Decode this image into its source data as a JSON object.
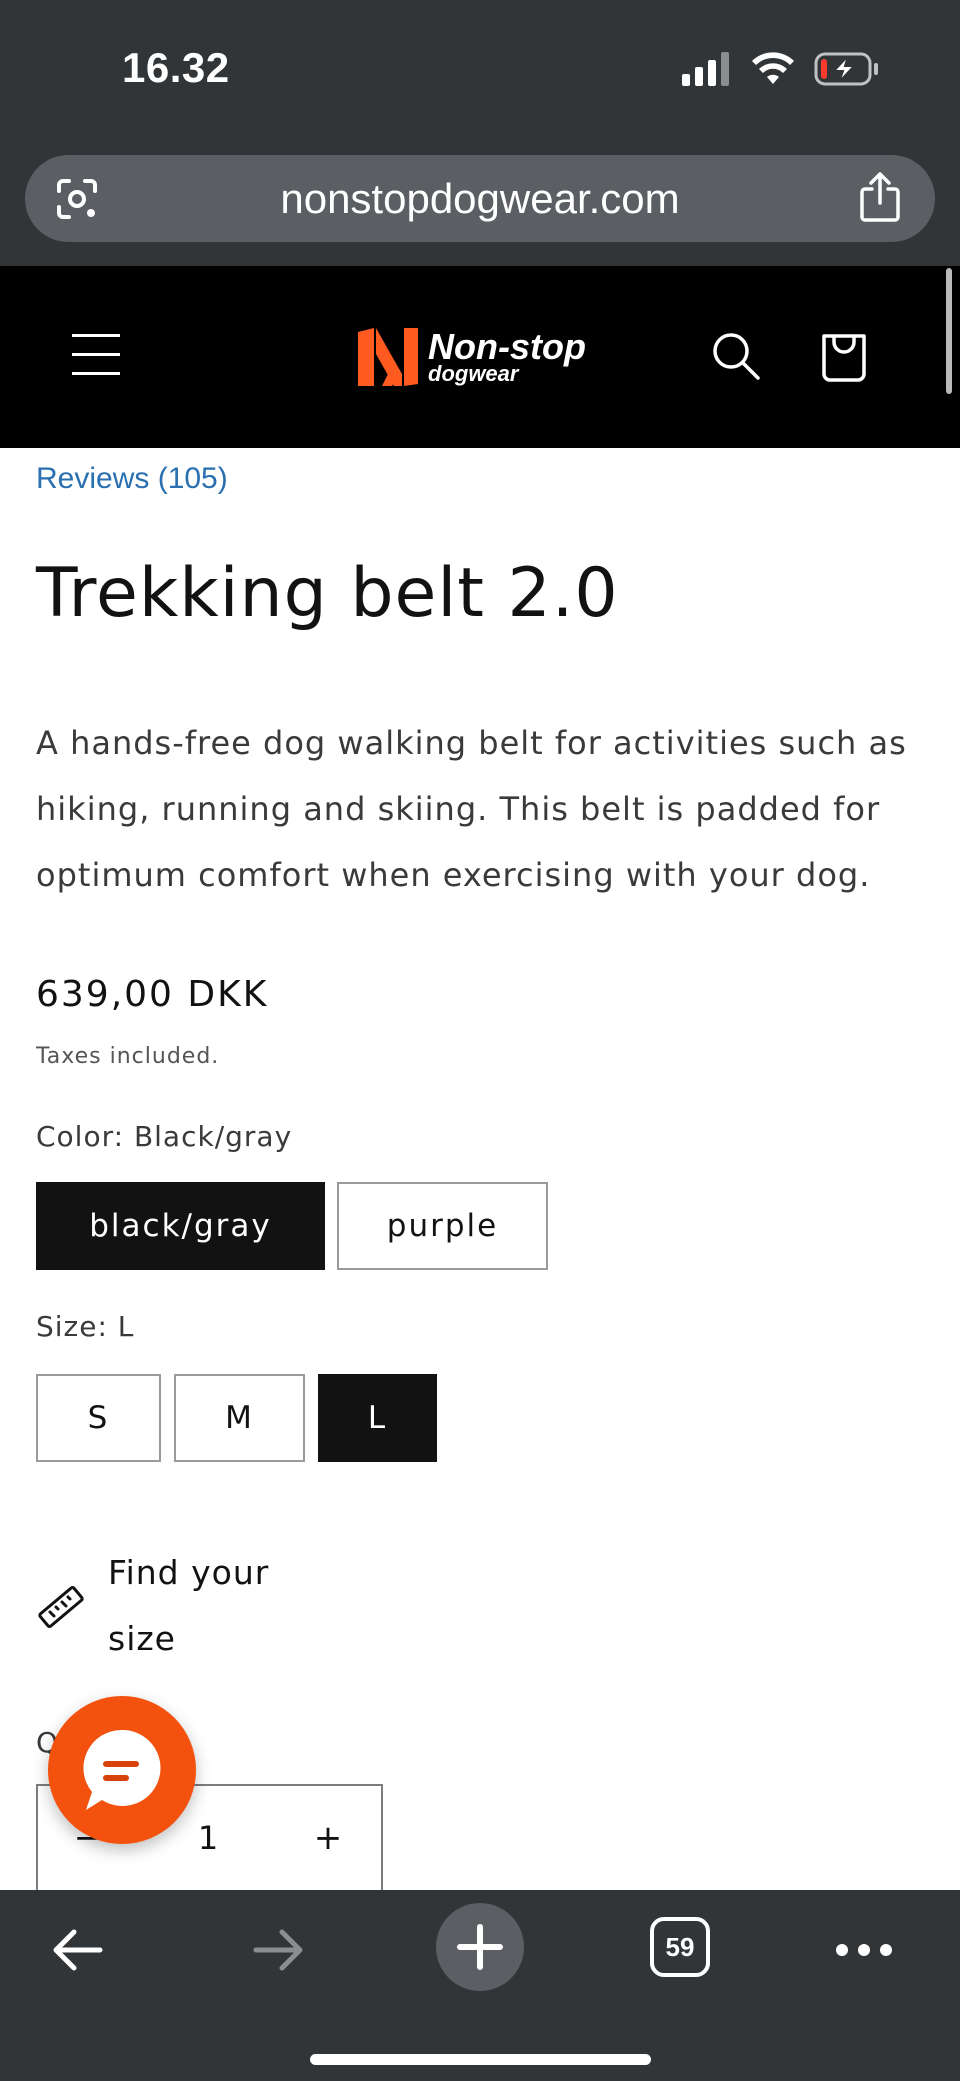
{
  "status_bar": {
    "time": "16.32",
    "icons": [
      "signal-icon",
      "wifi-icon",
      "battery-charging-icon"
    ]
  },
  "browser": {
    "url": "nonstopdogwear.com",
    "tab_count": "59",
    "icons": [
      "lens-icon",
      "share-icon",
      "back-arrow-icon",
      "forward-arrow-icon",
      "plus-icon",
      "more-dots-icon"
    ]
  },
  "header": {
    "brand_line1": "Non-stop",
    "brand_line2": "dogwear",
    "icons": [
      "hamburger-menu-icon",
      "search-icon",
      "bag-icon"
    ],
    "colors": {
      "background": "#000000",
      "logo_accent": "#ff5a1f"
    }
  },
  "product": {
    "reviews_link": "Reviews (105)",
    "title": "Trekking belt 2.0",
    "description": "A hands-free dog walking belt for activities such as hiking, running and skiing. This belt is padded for optimum comfort when exercising with your dog.",
    "price": "639,00 DKK",
    "tax_note": "Taxes included.",
    "color_label": "Color: Black/gray",
    "color_options": [
      {
        "label": "black/gray",
        "selected": true
      },
      {
        "label": "purple",
        "selected": false
      }
    ],
    "size_label": "Size: L",
    "size_options": [
      {
        "label": "S",
        "selected": false
      },
      {
        "label": "M",
        "selected": false
      },
      {
        "label": "L",
        "selected": true
      }
    ],
    "find_size": "Find your size",
    "quantity_label_partial": "Q",
    "quantity": {
      "minus": "−",
      "value": "1",
      "plus": "+"
    }
  },
  "chat_widget": {
    "icon": "chat-bubble-icon",
    "color": "#f3520e"
  }
}
